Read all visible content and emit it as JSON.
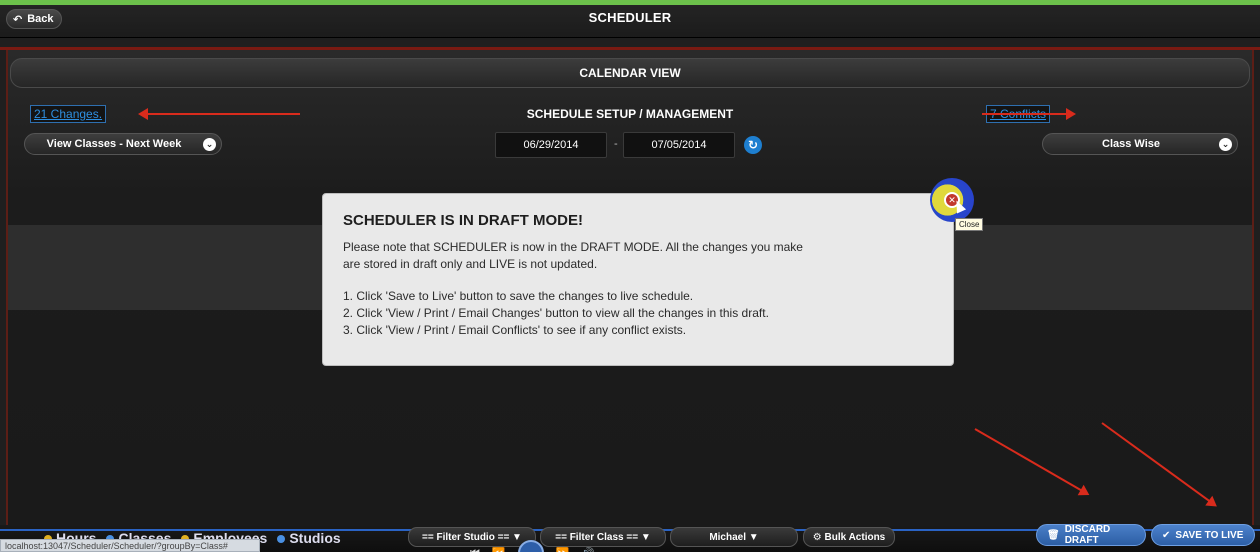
{
  "header": {
    "back_label": "Back",
    "title": "SCHEDULER"
  },
  "calendar": {
    "title": "CALENDAR VIEW",
    "subtitle": "SCHEDULE SETUP / MANAGEMENT"
  },
  "links": {
    "changes": "21 Changes.",
    "conflicts": "7 Conflicts"
  },
  "controls": {
    "view_select": "View Classes - Next Week",
    "group_select": "Class Wise",
    "date_start": "06/29/2014",
    "date_separator": "-",
    "date_end": "07/05/2014"
  },
  "modal": {
    "title": "SCHEDULER IS IN DRAFT MODE!",
    "line1": "Please note that SCHEDULER is now in the DRAFT MODE. All the changes you make",
    "line2": "are stored in draft only and LIVE is not updated.",
    "step1": "1. Click 'Save to Live' button to save the changes to live schedule.",
    "step2": "2. Click 'View / Print / Email Changes' button to view all the changes in this draft.",
    "step3": "3. Click 'View / Print / Email Conflicts' to see if any conflict exists.",
    "close_tooltip": "Close"
  },
  "legend": [
    "Hours",
    "Classes",
    "Employees",
    "Studios"
  ],
  "filters": {
    "studio": "== Filter Studio ==",
    "class": "== Filter Class ==",
    "employee": "Michael",
    "bulk": "Bulk Actions"
  },
  "actions": {
    "discard": "DISCARD DRAFT",
    "save": "SAVE TO LIVE"
  },
  "status_url": "localhost:13047/Scheduler/Scheduler/?groupBy=Class#",
  "colors": {
    "accent_green": "#6cc14b",
    "link_blue": "#2e8fe0",
    "arrow_red": "#d92b1c",
    "button_blue": "#2d5fa6"
  }
}
